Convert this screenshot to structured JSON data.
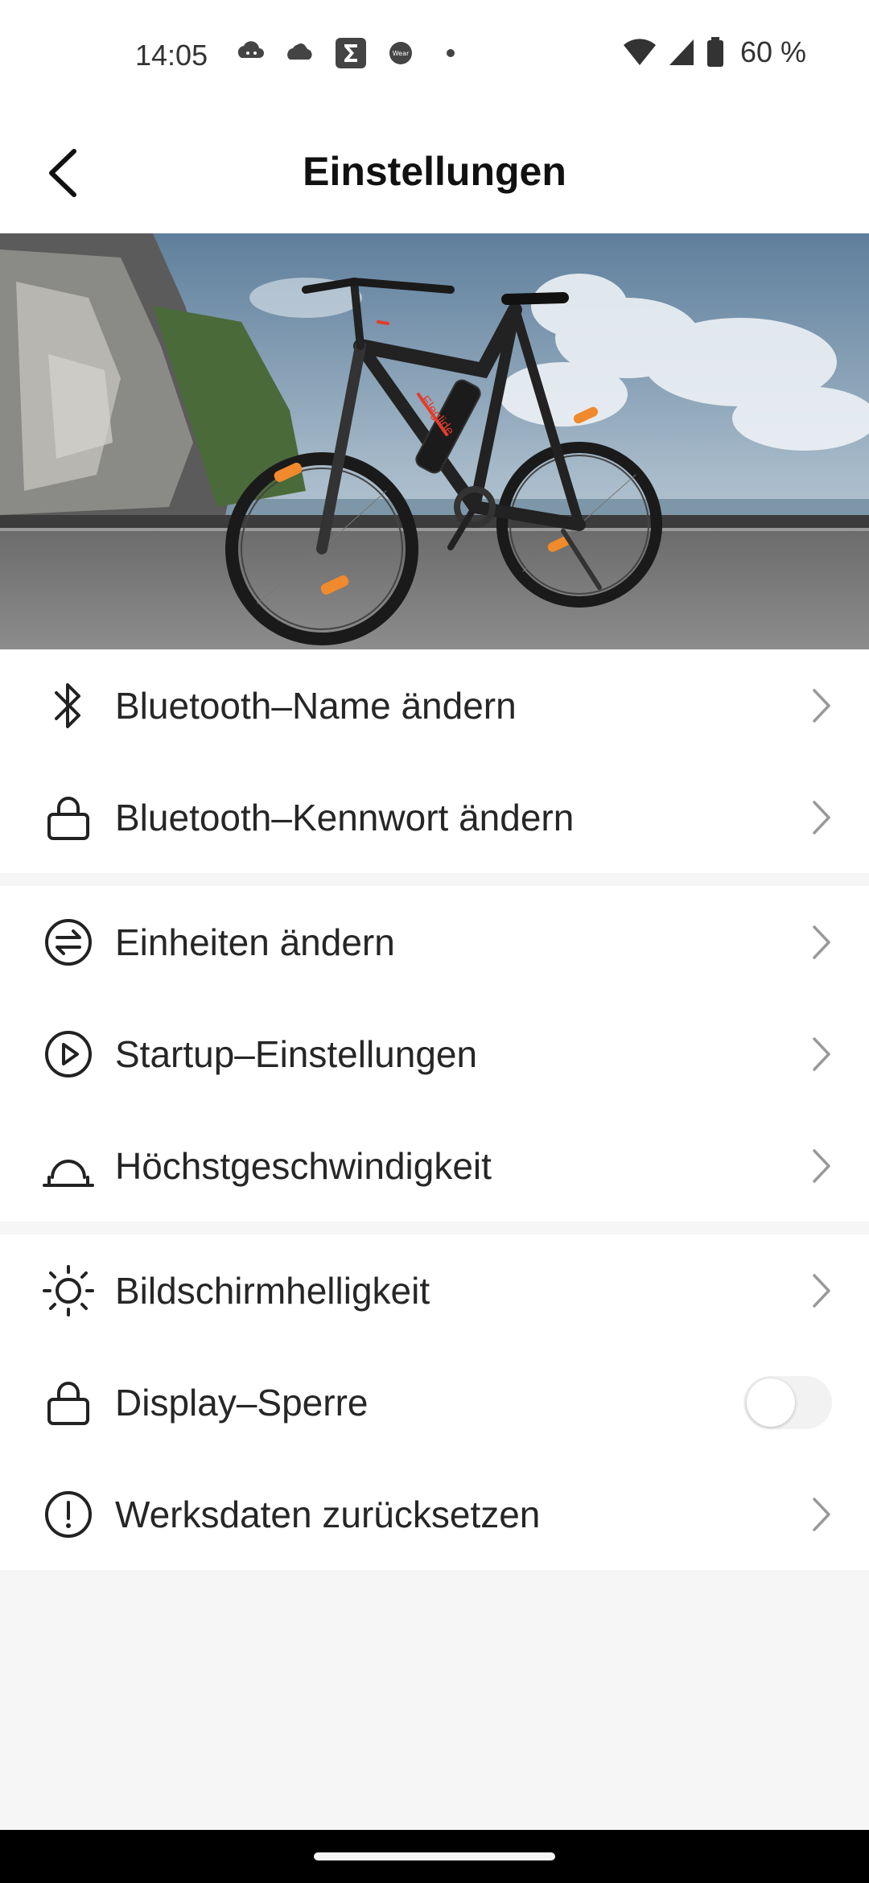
{
  "status_bar": {
    "time": "14:05",
    "left_icons": [
      "cloud-game-icon",
      "gear-cloud-icon",
      "sigma-app-icon",
      "wear-os-icon",
      "dot-icon"
    ],
    "wear_label": "Wear",
    "battery_percent": "60 %"
  },
  "header": {
    "title": "Einstellungen"
  },
  "hero": {
    "bike_brand": "Eleglide"
  },
  "settings": {
    "group1": [
      {
        "label": "Bluetooth–Name ändern",
        "icon": "bluetooth-icon"
      },
      {
        "label": "Bluetooth–Kennwort ändern",
        "icon": "lock-icon"
      }
    ],
    "group2": [
      {
        "label": "Einheiten ändern",
        "icon": "swap-units-icon"
      },
      {
        "label": "Startup–Einstellungen",
        "icon": "play-circle-icon"
      },
      {
        "label": "Höchstgeschwindigkeit",
        "icon": "speed-limit-icon"
      }
    ],
    "group3": [
      {
        "label": "Bildschirmhelligkeit",
        "icon": "sun-icon"
      },
      {
        "label": "Display–Sperre",
        "icon": "lock-icon",
        "toggle_on": false
      },
      {
        "label": "Werksdaten zurücksetzen",
        "icon": "alert-circle-icon"
      }
    ]
  },
  "colors": {
    "accent_orange": "#f08a2c",
    "bike_red": "#e23c2c",
    "background": "#f6f6f6"
  }
}
